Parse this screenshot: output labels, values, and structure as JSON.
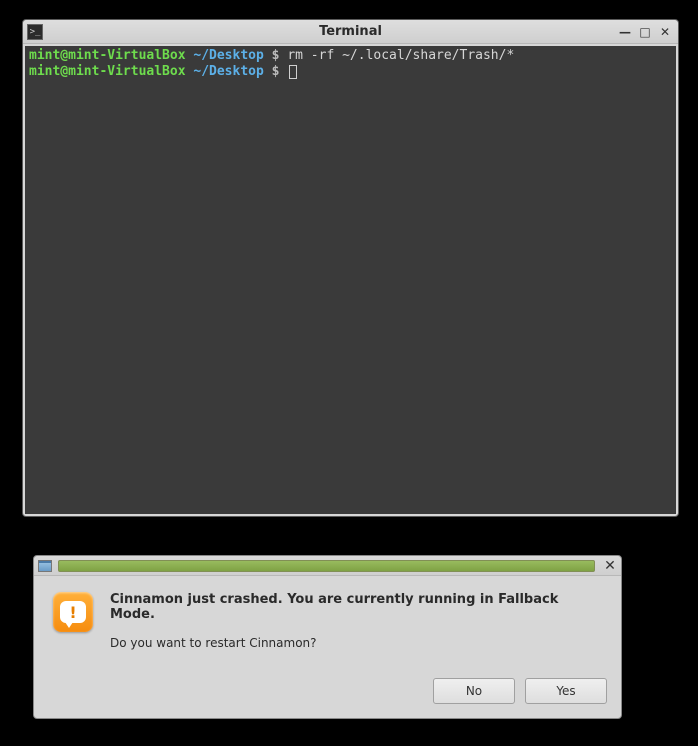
{
  "terminal": {
    "title": "Terminal",
    "icon_glyph": ">_",
    "lines": [
      {
        "user": "mint@mint-VirtualBox",
        "sep": " ",
        "path": "~/Desktop",
        "dollar": " $ ",
        "cmd": "rm -rf ~/.local/share/Trash/*"
      },
      {
        "user": "mint@mint-VirtualBox",
        "sep": " ",
        "path": "~/Desktop",
        "dollar": " $ ",
        "cmd": ""
      }
    ]
  },
  "dialog": {
    "heading": "Cinnamon just crashed. You are currently running in Fallback Mode.",
    "question": "Do you want to restart Cinnamon?",
    "warning_mark": "!",
    "no_label": "No",
    "yes_label": "Yes"
  },
  "window_controls": {
    "minimize": "—",
    "maximize": "□",
    "close": "✕"
  }
}
